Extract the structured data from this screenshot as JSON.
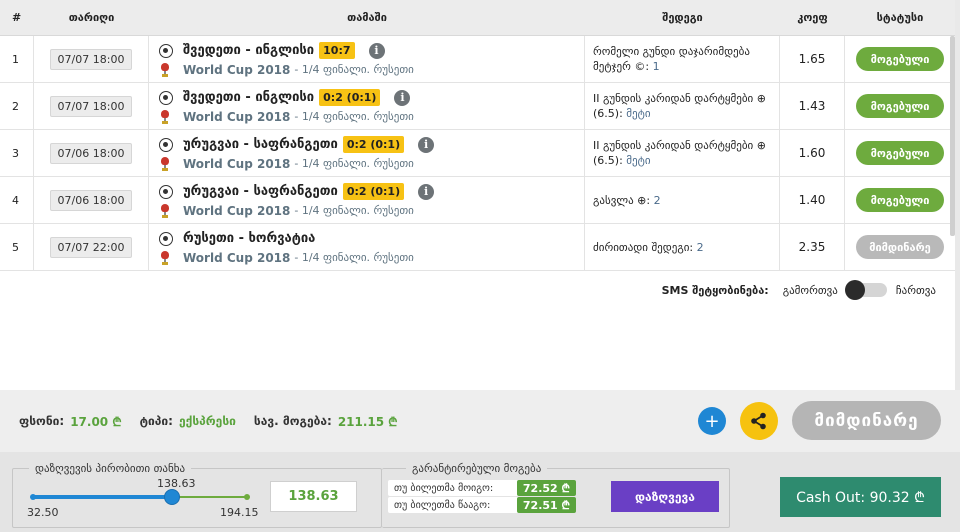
{
  "table": {
    "headers": {
      "num": "#",
      "date": "თარიღი",
      "match": "თამაში",
      "market": "შედეგი",
      "odds": "კოეფ",
      "status": "სტატუსი"
    },
    "rows": [
      {
        "num": "1",
        "date": "07/07 18:00",
        "teams": "შვედეთი - ინგლისი",
        "score": "10:7",
        "info": "i",
        "league": "World Cup 2018",
        "league_sub": "- 1/4 ფინალი. რუსეთი",
        "market_text": "რომელი გუნდი დაჯარიმდება მეტჯერ ©:",
        "market_value": "1",
        "odds": "1.65",
        "status": "მოგებული",
        "status_type": "win"
      },
      {
        "num": "2",
        "date": "07/07 18:00",
        "teams": "შვედეთი - ინგლისი",
        "score": "0:2 (0:1)",
        "info": "i",
        "league": "World Cup 2018",
        "league_sub": "- 1/4 ფინალი. რუსეთი",
        "market_text": "II გუნდის კარიდან დარტყმები ⊕ (6.5):",
        "market_value": "მეტი",
        "odds": "1.43",
        "status": "მოგებული",
        "status_type": "win"
      },
      {
        "num": "3",
        "date": "07/06 18:00",
        "teams": "ურუგვაი - საფრანგეთი",
        "score": "0:2 (0:1)",
        "info": "i",
        "league": "World Cup 2018",
        "league_sub": "- 1/4 ფინალი. რუსეთი",
        "market_text": "II გუნდის კარიდან დარტყმები ⊕ (6.5):",
        "market_value": "მეტი",
        "odds": "1.60",
        "status": "მოგებული",
        "status_type": "win"
      },
      {
        "num": "4",
        "date": "07/06 18:00",
        "teams": "ურუგვაი - საფრანგეთი",
        "score": "0:2 (0:1)",
        "info": "i",
        "league": "World Cup 2018",
        "league_sub": "- 1/4 ფინალი. რუსეთი",
        "market_text": "გასვლა ⊕:",
        "market_value": "2",
        "odds": "1.40",
        "status": "მოგებული",
        "status_type": "win"
      },
      {
        "num": "5",
        "date": "07/07 22:00",
        "teams": "რუსეთი - ხორვატია",
        "score": "",
        "info": "",
        "league": "World Cup 2018",
        "league_sub": "- 1/4 ფინალი. რუსეთი",
        "market_text": "ძირითადი შედეგი:",
        "market_value": "2",
        "odds": "2.35",
        "status": "მიმდინარე",
        "status_type": "pending"
      }
    ]
  },
  "sms": {
    "label": "SMS შეტყობინება:",
    "off": "გამორთვა",
    "on": "ჩართვა"
  },
  "summary": {
    "price_label": "ფსონი:",
    "price_value": "17.00 ₾",
    "type_label": "ტიპი:",
    "type_value": "ექსპრესი",
    "possible_label": "სავ. მოგება:",
    "possible_value": "211.15 ₾",
    "plus": "+",
    "current_button": "მიმდინარე"
  },
  "deposit": {
    "legend": "დაზღვევის პირობითი თანხა",
    "current": "138.63",
    "min": "32.50",
    "max": "194.15",
    "input_value": "138.63",
    "slider_fraction": 0.65
  },
  "guarantee": {
    "legend": "გარანტირებული მოგება",
    "win_label": "თუ ბილეთმა მოიგო:",
    "win_value": "72.52 ₾",
    "lose_label": "თუ ბილეთმა წააგო:",
    "lose_value": "72.51 ₾"
  },
  "buttons": {
    "deposit": "დაზღვევა",
    "cashout": "Cash Out: 90.32 ₾"
  },
  "colors": {
    "win": "#6eab3e",
    "pending": "#b9b9b9",
    "score_badge": "#f7c214",
    "deposit_button": "#6a3fc5",
    "cashout_button": "#2e8b6f"
  }
}
